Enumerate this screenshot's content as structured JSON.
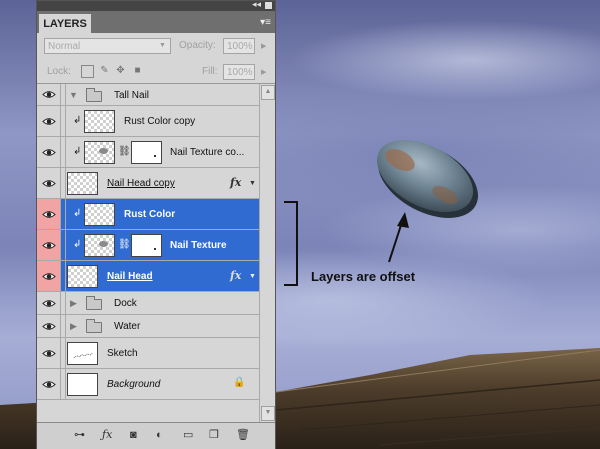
{
  "panel": {
    "tab_label": "LAYERS",
    "blend_mode": "Normal",
    "opacity_label": "Opacity:",
    "opacity_value": "100%",
    "lock_label": "Lock:",
    "fill_label": "Fill:",
    "fill_value": "100%",
    "layers": [
      {
        "name": "Tall Nail",
        "kind": "group",
        "expanded": true
      },
      {
        "name": "Rust Color copy",
        "kind": "layer"
      },
      {
        "name": "Nail Texture co...",
        "kind": "masked-layer"
      },
      {
        "name": "Nail Head copy",
        "kind": "layer",
        "fx": "fx"
      },
      {
        "name": "Rust Color",
        "kind": "layer",
        "selected": true
      },
      {
        "name": "Nail Texture",
        "kind": "masked-layer",
        "selected": true
      },
      {
        "name": "Nail Head",
        "kind": "layer",
        "fx": "fx",
        "selected": true
      },
      {
        "name": "Dock",
        "kind": "group",
        "expanded": false
      },
      {
        "name": "Water",
        "kind": "group",
        "expanded": false
      },
      {
        "name": "Sketch",
        "kind": "layer"
      },
      {
        "name": "Background",
        "kind": "layer",
        "locked": true
      }
    ],
    "bottom_icons": [
      "link-icon",
      "fx-icon",
      "mask-icon",
      "adjustment-icon",
      "folder-icon",
      "new-layer-icon",
      "trash-icon"
    ]
  },
  "annotation": {
    "text": "Layers are offset"
  }
}
